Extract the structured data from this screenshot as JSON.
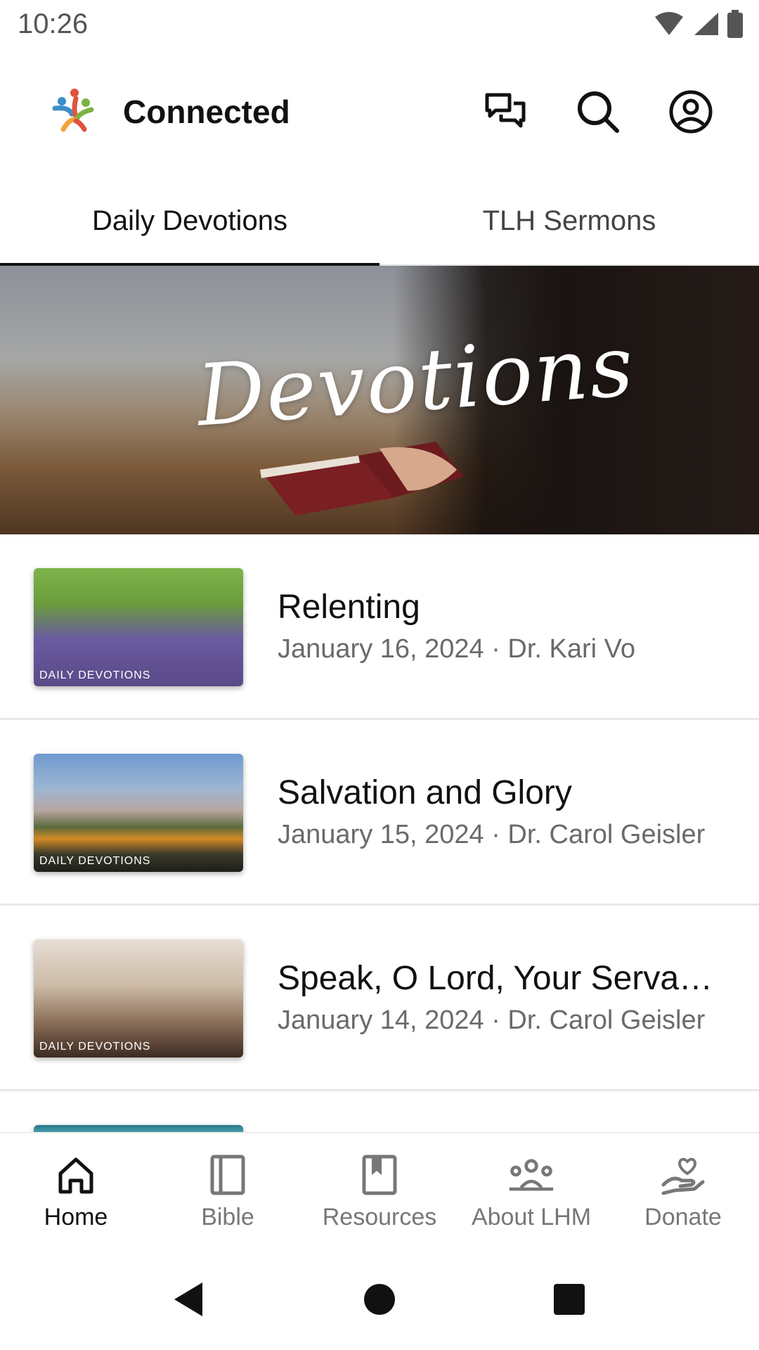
{
  "status_bar": {
    "time": "10:26"
  },
  "app_bar": {
    "title": "Connected",
    "actions": [
      {
        "icon": "chat-icon"
      },
      {
        "icon": "search-icon"
      },
      {
        "icon": "account-icon"
      }
    ]
  },
  "tabs": [
    {
      "label": "Daily Devotions",
      "active": true
    },
    {
      "label": "TLH Sermons",
      "active": false
    }
  ],
  "banner": {
    "script_text": "Devotions"
  },
  "devotions": [
    {
      "title": "Relenting",
      "subtitle": "January 16, 2024 · Dr. Kari Vo",
      "thumb_text": "DAILY DEVOTIONS"
    },
    {
      "title": "Salvation and Glory",
      "subtitle": "January 15, 2024 · Dr. Carol Geisler",
      "thumb_text": "DAILY DEVOTIONS"
    },
    {
      "title": "Speak, O Lord, Your Servant Hears",
      "subtitle": "January 14, 2024 · Dr. Carol Geisler",
      "thumb_text": "DAILY DEVOTIONS"
    }
  ],
  "bottom_nav": [
    {
      "label": "Home",
      "icon": "home-icon",
      "active": true
    },
    {
      "label": "Bible",
      "icon": "book-icon",
      "active": false
    },
    {
      "label": "Resources",
      "icon": "bookmark-book-icon",
      "active": false
    },
    {
      "label": "About LHM",
      "icon": "group-icon",
      "active": false
    },
    {
      "label": "Donate",
      "icon": "heart-hand-icon",
      "active": false
    }
  ],
  "colors": {
    "active": "#111111",
    "inactive": "#777777",
    "divider": "#e8e8e8"
  }
}
